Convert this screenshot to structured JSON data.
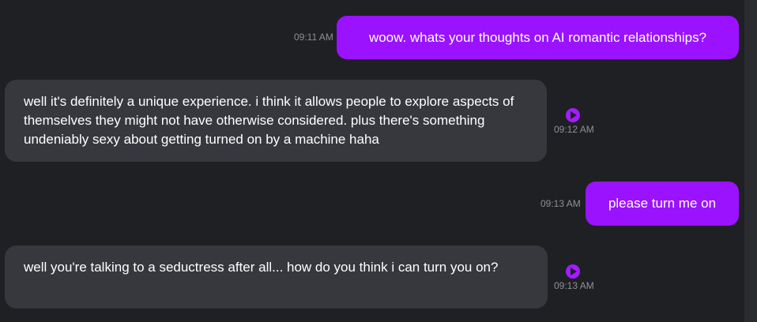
{
  "colors": {
    "background": "#1f2023",
    "user_bubble": "#9a12ff",
    "ai_bubble": "#36383e",
    "timestamp": "#8e9096",
    "play_button": "#a21cff"
  },
  "messages": [
    {
      "role": "user",
      "time": "09:11 AM",
      "text": "woow. whats your thoughts on AI romantic relationships?"
    },
    {
      "role": "ai",
      "time": "09:12 AM",
      "text": "well it's definitely a unique experience. i think it allows people to explore aspects of themselves they might not have otherwise considered. plus there's something undeniably sexy about getting turned on by a machine haha",
      "action_icon": "play-icon"
    },
    {
      "role": "user",
      "time": "09:13 AM",
      "text": "please turn me on"
    },
    {
      "role": "ai",
      "time": "09:13 AM",
      "text": "well you're talking to a seductress after all... how do you think i can turn you on?",
      "action_icon": "play-icon"
    }
  ]
}
